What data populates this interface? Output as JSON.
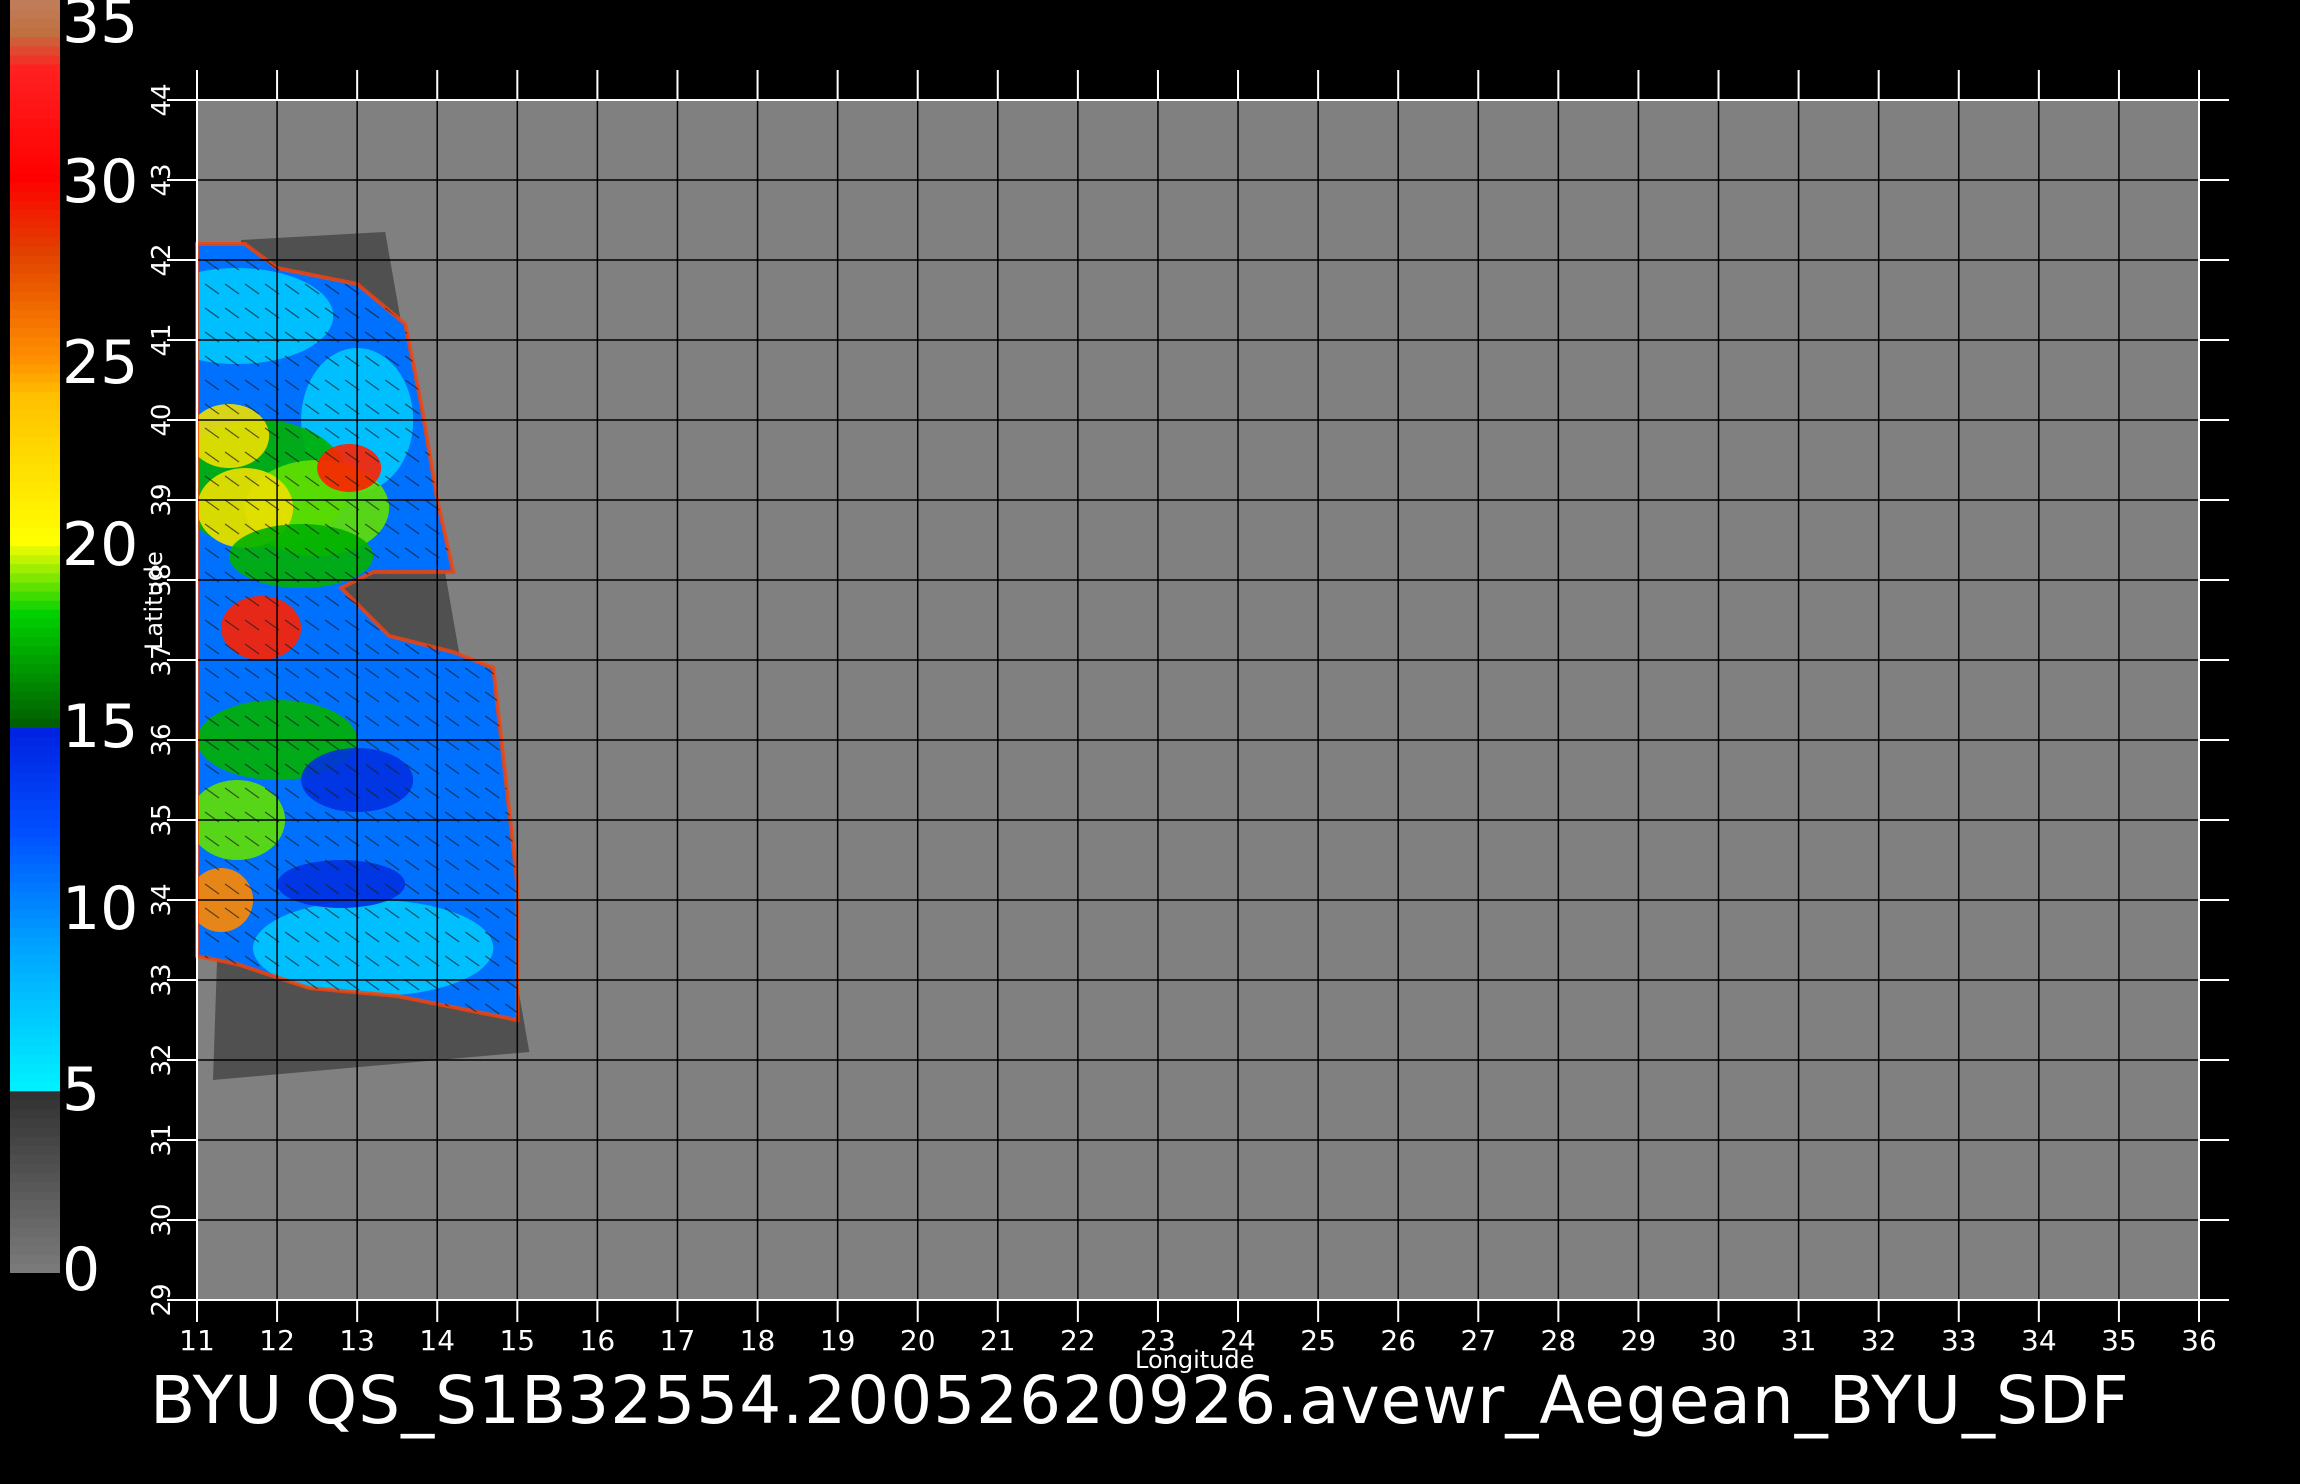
{
  "caption": "BYU QS_S1B32554.20052620926.avewr_Aegean_BYU_SDF",
  "x_axis": {
    "title": "Longitude",
    "ticks": [
      "11",
      "12",
      "13",
      "14",
      "15",
      "16",
      "17",
      "18",
      "19",
      "20",
      "21",
      "22",
      "23",
      "24",
      "25",
      "26",
      "27",
      "28",
      "29",
      "30",
      "31",
      "32",
      "33",
      "34",
      "35",
      "36"
    ]
  },
  "y_axis": {
    "title": "Latitude",
    "ticks": [
      "29",
      "30",
      "31",
      "32",
      "33",
      "34",
      "35",
      "36",
      "37",
      "38",
      "39",
      "40",
      "41",
      "42",
      "43",
      "44"
    ]
  },
  "colorbar": {
    "labels": [
      "0",
      "5",
      "10",
      "15",
      "20",
      "25",
      "30",
      "35"
    ],
    "colors": [
      "#7a7a7a",
      "#00f0ff",
      "#0033ff",
      "#00d000",
      "#ffff00",
      "#ff5000",
      "#ff0000",
      "#c07040"
    ]
  },
  "map": {
    "background": "#808080",
    "swath_color": "#505050",
    "wind_palette": [
      "#00c8ff",
      "#0070ff",
      "#0030e0",
      "#00b000",
      "#60e000",
      "#f0e000",
      "#ff8800",
      "#ff2000"
    ]
  }
}
